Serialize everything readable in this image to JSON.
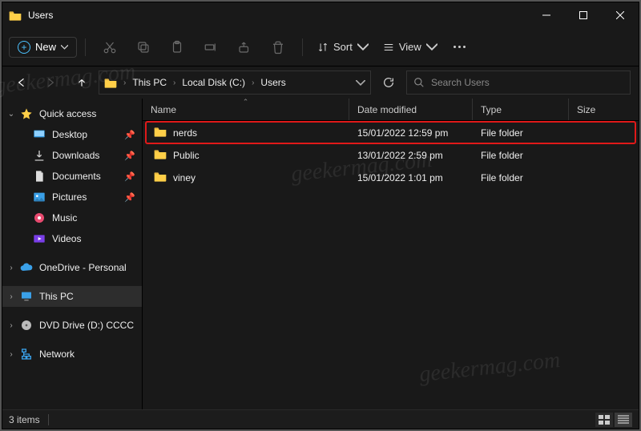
{
  "window": {
    "title": "Users"
  },
  "toolbar": {
    "new_label": "New",
    "sort_label": "Sort",
    "view_label": "View"
  },
  "breadcrumb": {
    "items": [
      "This PC",
      "Local Disk (C:)",
      "Users"
    ]
  },
  "search": {
    "placeholder": "Search Users"
  },
  "sidebar": {
    "quick_access": "Quick access",
    "items": [
      {
        "label": "Desktop"
      },
      {
        "label": "Downloads"
      },
      {
        "label": "Documents"
      },
      {
        "label": "Pictures"
      },
      {
        "label": "Music"
      },
      {
        "label": "Videos"
      }
    ],
    "onedrive": "OneDrive - Personal",
    "this_pc": "This PC",
    "dvd": "DVD Drive (D:) CCCC",
    "network": "Network"
  },
  "columns": {
    "name": "Name",
    "date": "Date modified",
    "type": "Type",
    "size": "Size"
  },
  "rows": [
    {
      "name": "nerds",
      "date": "15/01/2022 12:59 pm",
      "type": "File folder",
      "highlighted": true
    },
    {
      "name": "Public",
      "date": "13/01/2022 2:59 pm",
      "type": "File folder",
      "highlighted": false
    },
    {
      "name": "viney",
      "date": "15/01/2022 1:01 pm",
      "type": "File folder",
      "highlighted": false
    }
  ],
  "status": {
    "count_label": "3 items"
  },
  "watermark": "geekermag.com"
}
